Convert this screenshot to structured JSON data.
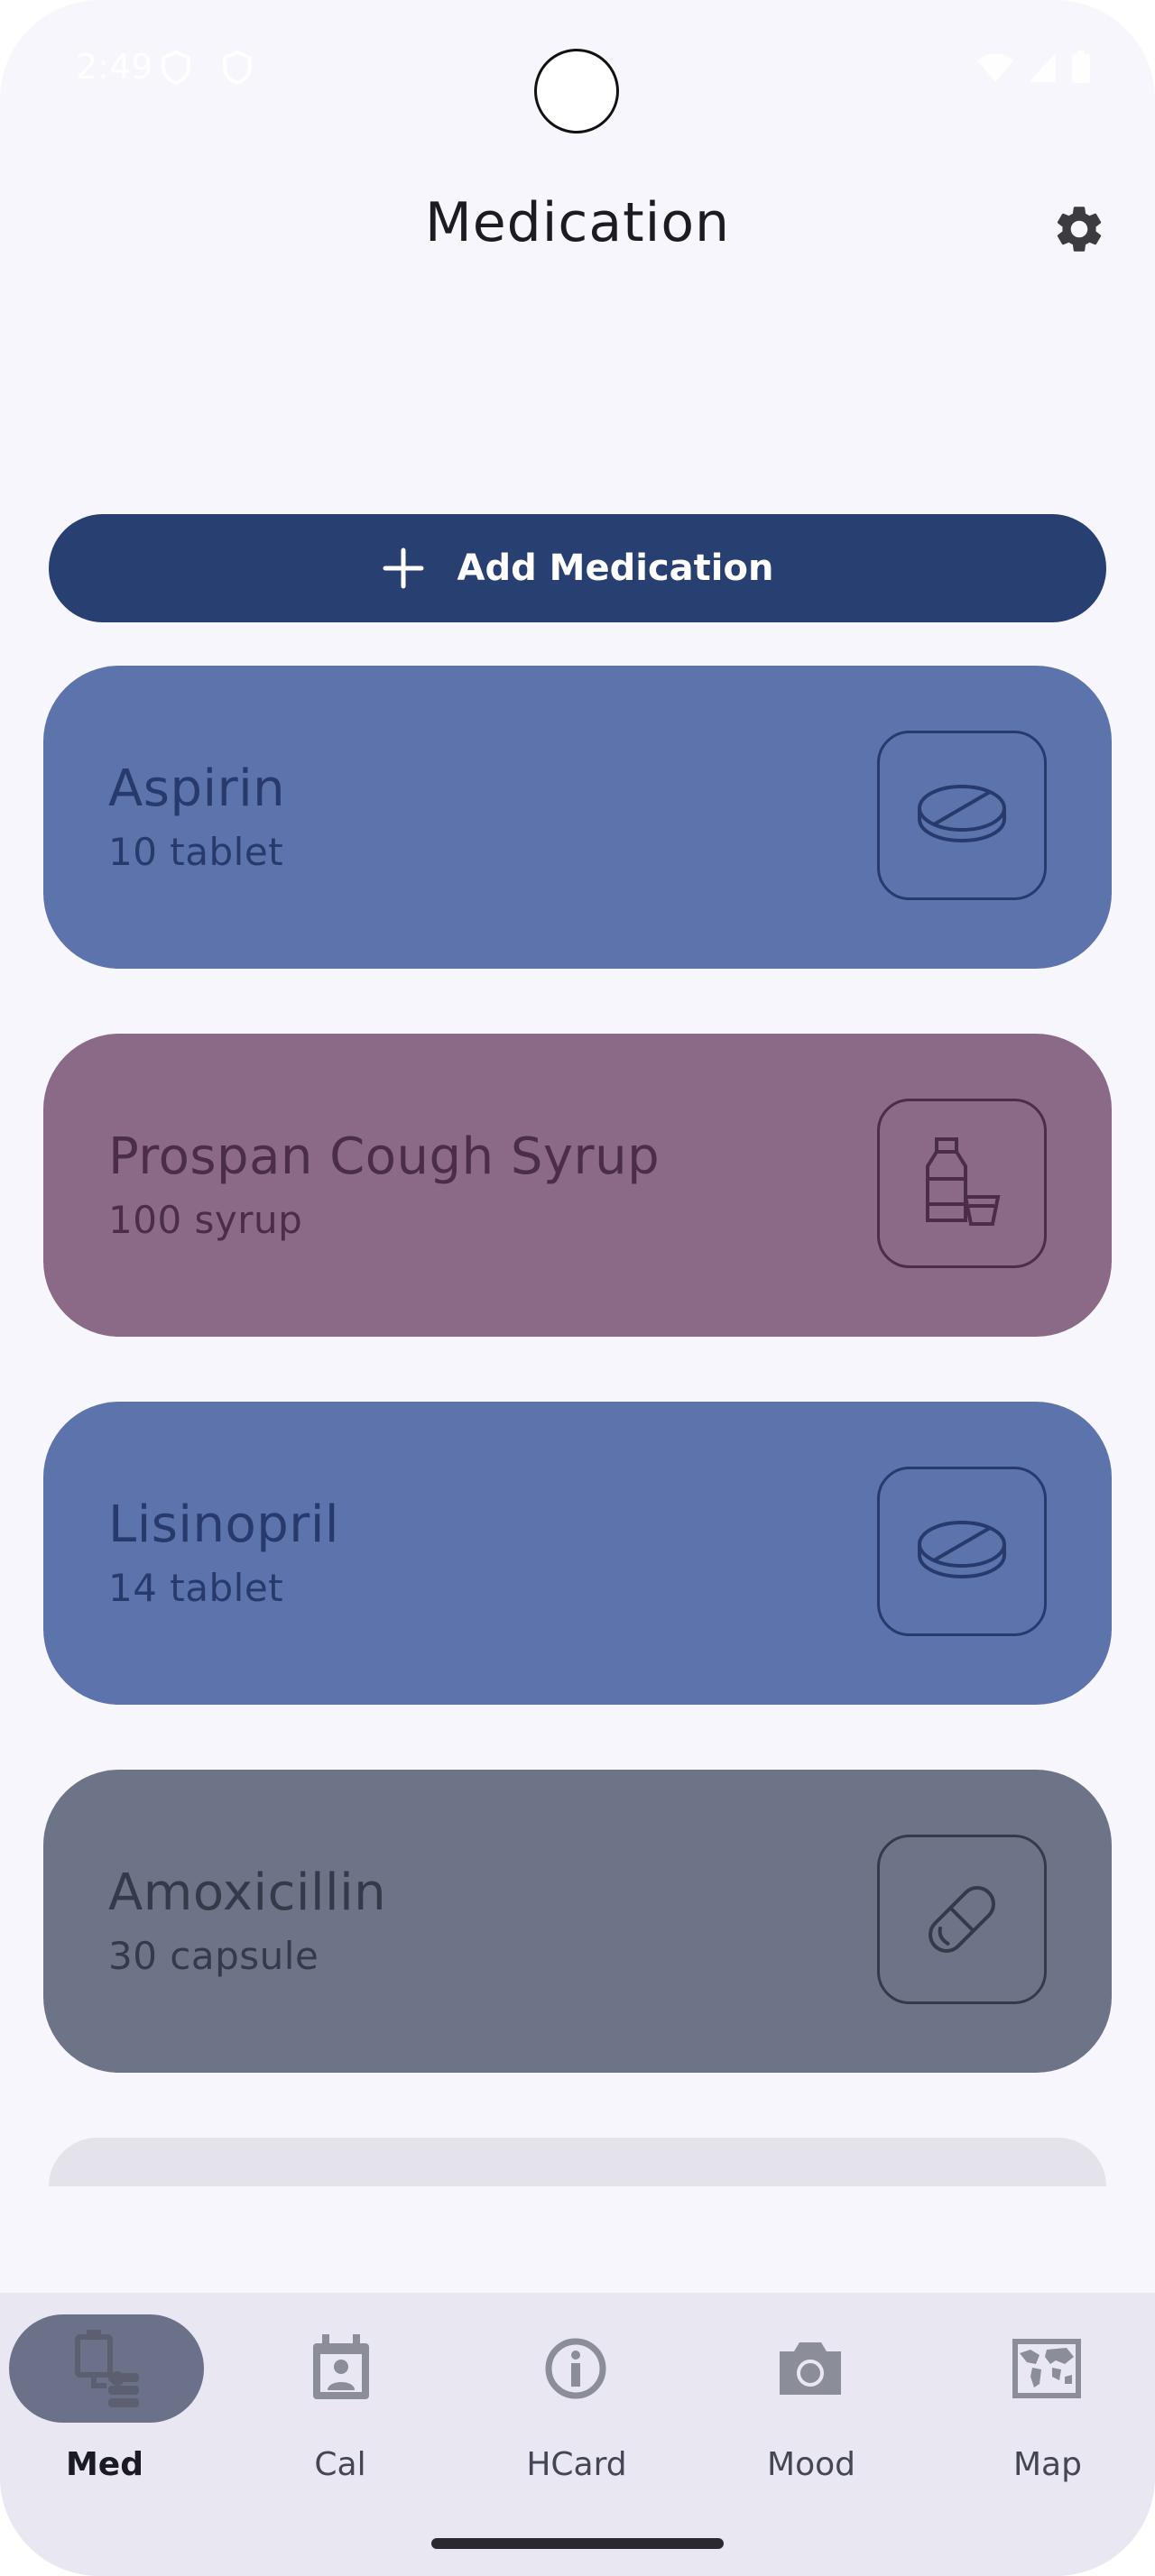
{
  "status_bar": {
    "time": "2:49"
  },
  "header": {
    "title": "Medication"
  },
  "add_button": {
    "label": "Add Medication"
  },
  "medications": [
    {
      "name": "Aspirin",
      "dose": "10 tablet",
      "icon": "pill-tablet-icon",
      "bg": "#5c73ab",
      "fg": "#273a6b"
    },
    {
      "name": "Prospan Cough Syrup",
      "dose": "100 syrup",
      "icon": "syrup-bottle-icon",
      "bg": "#8a6a86",
      "fg": "#4a2d47"
    },
    {
      "name": "Lisinopril",
      "dose": "14 tablet",
      "icon": "pill-tablet-icon",
      "bg": "#5c73ab",
      "fg": "#273a6b"
    },
    {
      "name": "Amoxicillin",
      "dose": "30 capsule",
      "icon": "capsule-icon",
      "bg": "#6d7487",
      "fg": "#343a4a"
    }
  ],
  "bottom_nav": {
    "items": [
      {
        "label": "Med",
        "icon": "medication-icon",
        "active": true
      },
      {
        "label": "Cal",
        "icon": "calendar-contact-icon",
        "active": false
      },
      {
        "label": "HCard",
        "icon": "info-icon",
        "active": false
      },
      {
        "label": "Mood",
        "icon": "camera-icon",
        "active": false
      },
      {
        "label": "Map",
        "icon": "world-map-icon",
        "active": false
      }
    ]
  },
  "colors": {
    "background": "#f7f6fc",
    "primary": "#283f72",
    "nav_background": "#e8e7f2",
    "nav_active_pill": "#6b7189"
  }
}
